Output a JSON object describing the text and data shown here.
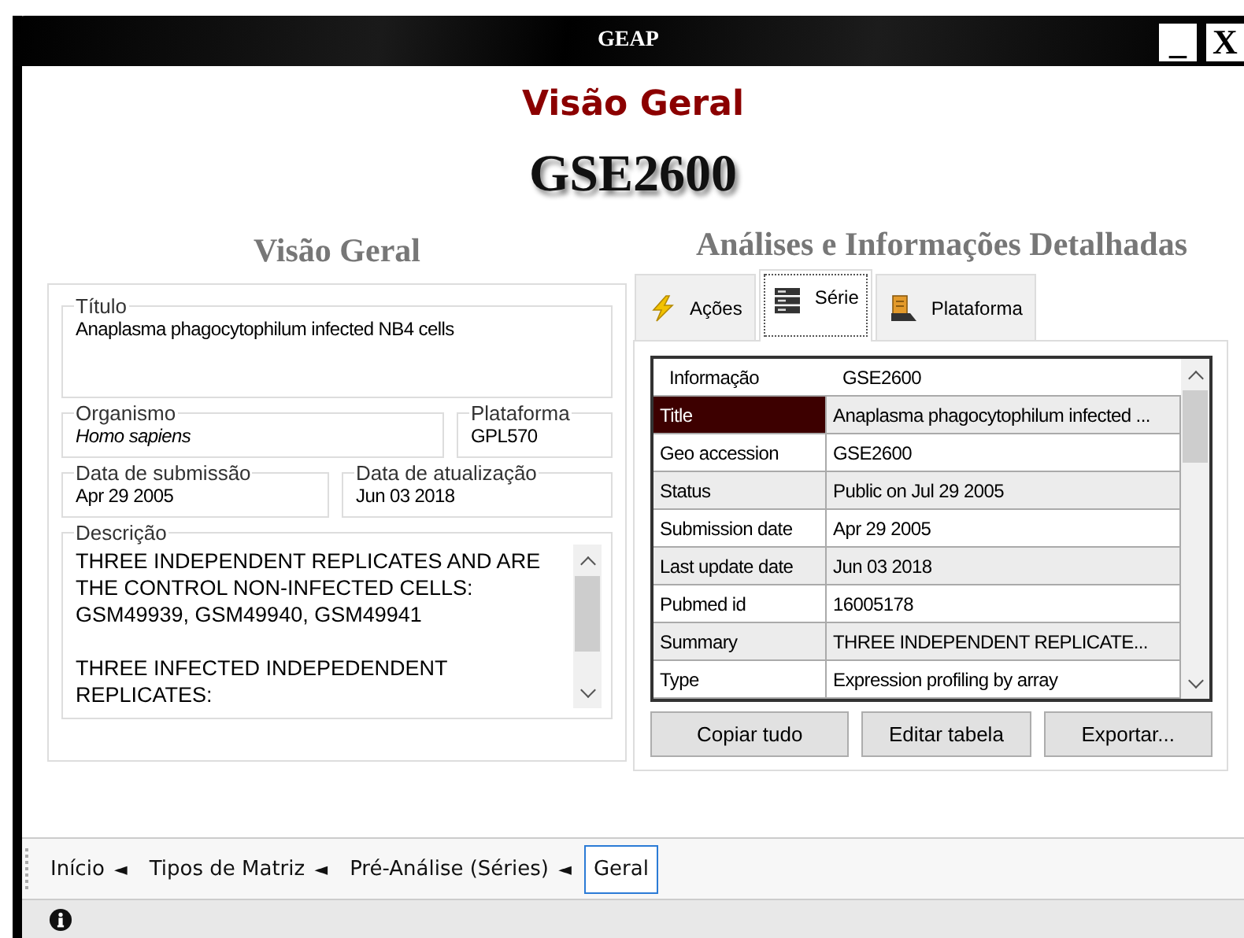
{
  "window": {
    "title": "GEAP",
    "controls": [
      "_",
      "X"
    ]
  },
  "page_title": "Visão Geral",
  "series_id": "GSE2600",
  "overview": {
    "heading": "Visão Geral",
    "rows": [
      [
        {
          "label": "Título",
          "value": "Anaplasma phagocytophilum infected NB4 cells",
          "italic": false
        }
      ],
      [
        {
          "label": "Organismo",
          "value": "Homo sapiens",
          "italic": true
        },
        {
          "label": "Plataforma",
          "value": "GPL570",
          "italic": false
        }
      ],
      [
        {
          "label": "Data de submissão",
          "value": "Apr 29 2005",
          "italic": false
        },
        {
          "label": "Data de atualização",
          "value": "Jun 03 2018",
          "italic": false
        }
      ]
    ],
    "description": {
      "label": "Descrição",
      "value": "THREE INDEPENDENT REPLICATES AND ARE THE CONTROL NON-INFECTED CELLS: GSM49939, GSM49940, GSM49941\n\nTHREE INFECTED INDEPEDENDENT REPLICATES:"
    }
  },
  "details": {
    "heading": "Análises e Informações Detalhadas",
    "tabs": [
      {
        "label": "Ações",
        "kind": "actions",
        "selected": false
      },
      {
        "label": "Série",
        "kind": "series",
        "selected": true
      },
      {
        "label": "Plataforma",
        "kind": "platform",
        "selected": false
      }
    ],
    "table": {
      "columns": [
        "Informação",
        "GSE2600"
      ],
      "rows": [
        {
          "cells": [
            "Title",
            "Anaplasma phagocytophilum infected ..."
          ],
          "selected": true
        },
        {
          "cells": [
            "Geo accession",
            "GSE2600"
          ],
          "selected": false
        },
        {
          "cells": [
            "Status",
            "Public on Jul 29 2005"
          ],
          "selected": false
        },
        {
          "cells": [
            "Submission date",
            "Apr 29 2005"
          ],
          "selected": false
        },
        {
          "cells": [
            "Last update date",
            "Jun 03 2018"
          ],
          "selected": false
        },
        {
          "cells": [
            "Pubmed id",
            "16005178"
          ],
          "selected": false
        },
        {
          "cells": [
            "Summary",
            "THREE INDEPENDENT REPLICATE..."
          ],
          "selected": false
        },
        {
          "cells": [
            "Type",
            "Expression profiling by array"
          ],
          "selected": false
        }
      ]
    },
    "buttons": [
      "Copiar tudo",
      "Editar tabela",
      "Exportar..."
    ]
  },
  "breadcrumbs": [
    {
      "label": "Início",
      "separator": "◄",
      "selected": false
    },
    {
      "label": "Tipos de Matriz",
      "separator": "◄",
      "selected": false
    },
    {
      "label": "Pré-Análise (Séries)",
      "separator": "◄",
      "selected": false
    },
    {
      "label": "Geral",
      "selected": true
    }
  ]
}
